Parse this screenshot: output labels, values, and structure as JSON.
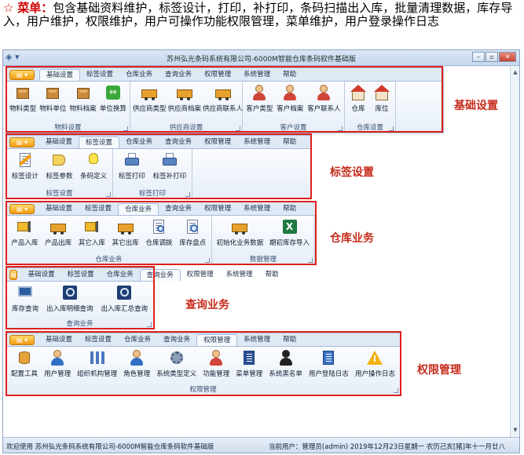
{
  "intro": {
    "star": "☆",
    "lead": "菜单：",
    "text": "包含基础资料维护，标签设计，打印，补打印，条码扫描出入库，批量清理数据，库存导入，用户维护，权限维护，用户可操作功能权限管理，菜单维护，用户登录操作日志"
  },
  "window": {
    "title": "苏州弘光条码系统有限公司-6000M智能仓库条码软件基础版",
    "qat_icon": "app-logo-icon",
    "appmenu_label": "▤ ▾",
    "min": "–",
    "max": "▫",
    "close": "✕"
  },
  "tabs": [
    "基础设置",
    "标签设置",
    "仓库业务",
    "查询业务",
    "权限管理",
    "系统管理",
    "帮助"
  ],
  "ribbons": [
    {
      "active_tab": 0,
      "annotation": "基础设置",
      "groups": [
        {
          "label": "物料设置",
          "items": [
            {
              "label": "物料类型",
              "icon": "box-icon"
            },
            {
              "label": "物料单位",
              "icon": "box-icon"
            },
            {
              "label": "物料档案",
              "icon": "box-icon"
            },
            {
              "label": "单位换算",
              "icon": "convert-icon"
            }
          ]
        },
        {
          "label": "供应商设置",
          "items": [
            {
              "label": "供应商类型",
              "icon": "truck-icon"
            },
            {
              "label": "供应商档案",
              "icon": "truck-icon"
            },
            {
              "label": "供应商联系人",
              "icon": "truck-icon"
            }
          ]
        },
        {
          "label": "客户设置",
          "items": [
            {
              "label": "客户类型",
              "icon": "customer-icon"
            },
            {
              "label": "客户档案",
              "icon": "customer-icon"
            },
            {
              "label": "客户联系人",
              "icon": "customer-icon"
            }
          ]
        },
        {
          "label": "仓库设置",
          "items": [
            {
              "label": "仓库",
              "icon": "warehouse-icon"
            },
            {
              "label": "库位",
              "icon": "warehouse-icon"
            }
          ]
        }
      ]
    },
    {
      "active_tab": 1,
      "annotation": "标签设置",
      "groups": [
        {
          "label": "标签设置",
          "items": [
            {
              "label": "标签设计",
              "icon": "label-design-icon"
            },
            {
              "label": "标签参数",
              "icon": "tag-icon"
            },
            {
              "label": "条码定义",
              "icon": "bulb-icon"
            }
          ]
        },
        {
          "label": "标签打印",
          "items": [
            {
              "label": "标签打印",
              "icon": "printer-icon"
            },
            {
              "label": "标签补打印",
              "icon": "printer-icon"
            }
          ]
        }
      ]
    },
    {
      "active_tab": 2,
      "annotation": "仓库业务",
      "groups": [
        {
          "label": "仓库业务",
          "items": [
            {
              "label": "产品入库",
              "icon": "forklift-icon"
            },
            {
              "label": "产品出库",
              "icon": "truck-icon"
            },
            {
              "label": "其它入库",
              "icon": "forklift-icon"
            },
            {
              "label": "其它出库",
              "icon": "truck-icon"
            },
            {
              "label": "仓库调拨",
              "icon": "transfer-icon"
            },
            {
              "label": "库存盘点",
              "icon": "inventory-icon"
            }
          ]
        },
        {
          "label": "数据管理",
          "items": [
            {
              "label": "初始化业务数据",
              "icon": "truck-icon"
            },
            {
              "label": "期初库存导入",
              "icon": "excel-icon"
            }
          ]
        }
      ]
    },
    {
      "active_tab": 3,
      "annotation": "查询业务",
      "groups": [
        {
          "label": "查询业务",
          "items": [
            {
              "label": "库存查询",
              "icon": "monitor-icon"
            },
            {
              "label": "出入库明细查询",
              "icon": "search-icon"
            },
            {
              "label": "出入库汇总查询",
              "icon": "search-icon"
            }
          ]
        }
      ]
    },
    {
      "active_tab": 4,
      "annotation": "权限管理",
      "groups": [
        {
          "label": "权限管理",
          "items": [
            {
              "label": "配置工具",
              "icon": "database-icon"
            },
            {
              "label": "用户管理",
              "icon": "user-icon"
            },
            {
              "label": "组织机构管理",
              "icon": "org-icon"
            },
            {
              "label": "角色管理",
              "icon": "role-icon"
            },
            {
              "label": "系统类型定义",
              "icon": "gear-icon"
            },
            {
              "label": "功能管理",
              "icon": "function-icon"
            },
            {
              "label": "菜单管理",
              "icon": "book-icon"
            },
            {
              "label": "系统黑名单",
              "icon": "blacklist-icon"
            },
            {
              "label": "用户登陆日志",
              "icon": "log-icon"
            },
            {
              "label": "用户操作日志",
              "icon": "warning-icon"
            }
          ]
        }
      ]
    }
  ],
  "statusbar": {
    "left": "欢迎使用 苏州弘光条码系统有限公司-6000M智能仓库条码软件基础版",
    "right": "当前用户：管理员(admin)  2019年12月23日星期一 农历己亥[猪]年十一月廿八"
  }
}
